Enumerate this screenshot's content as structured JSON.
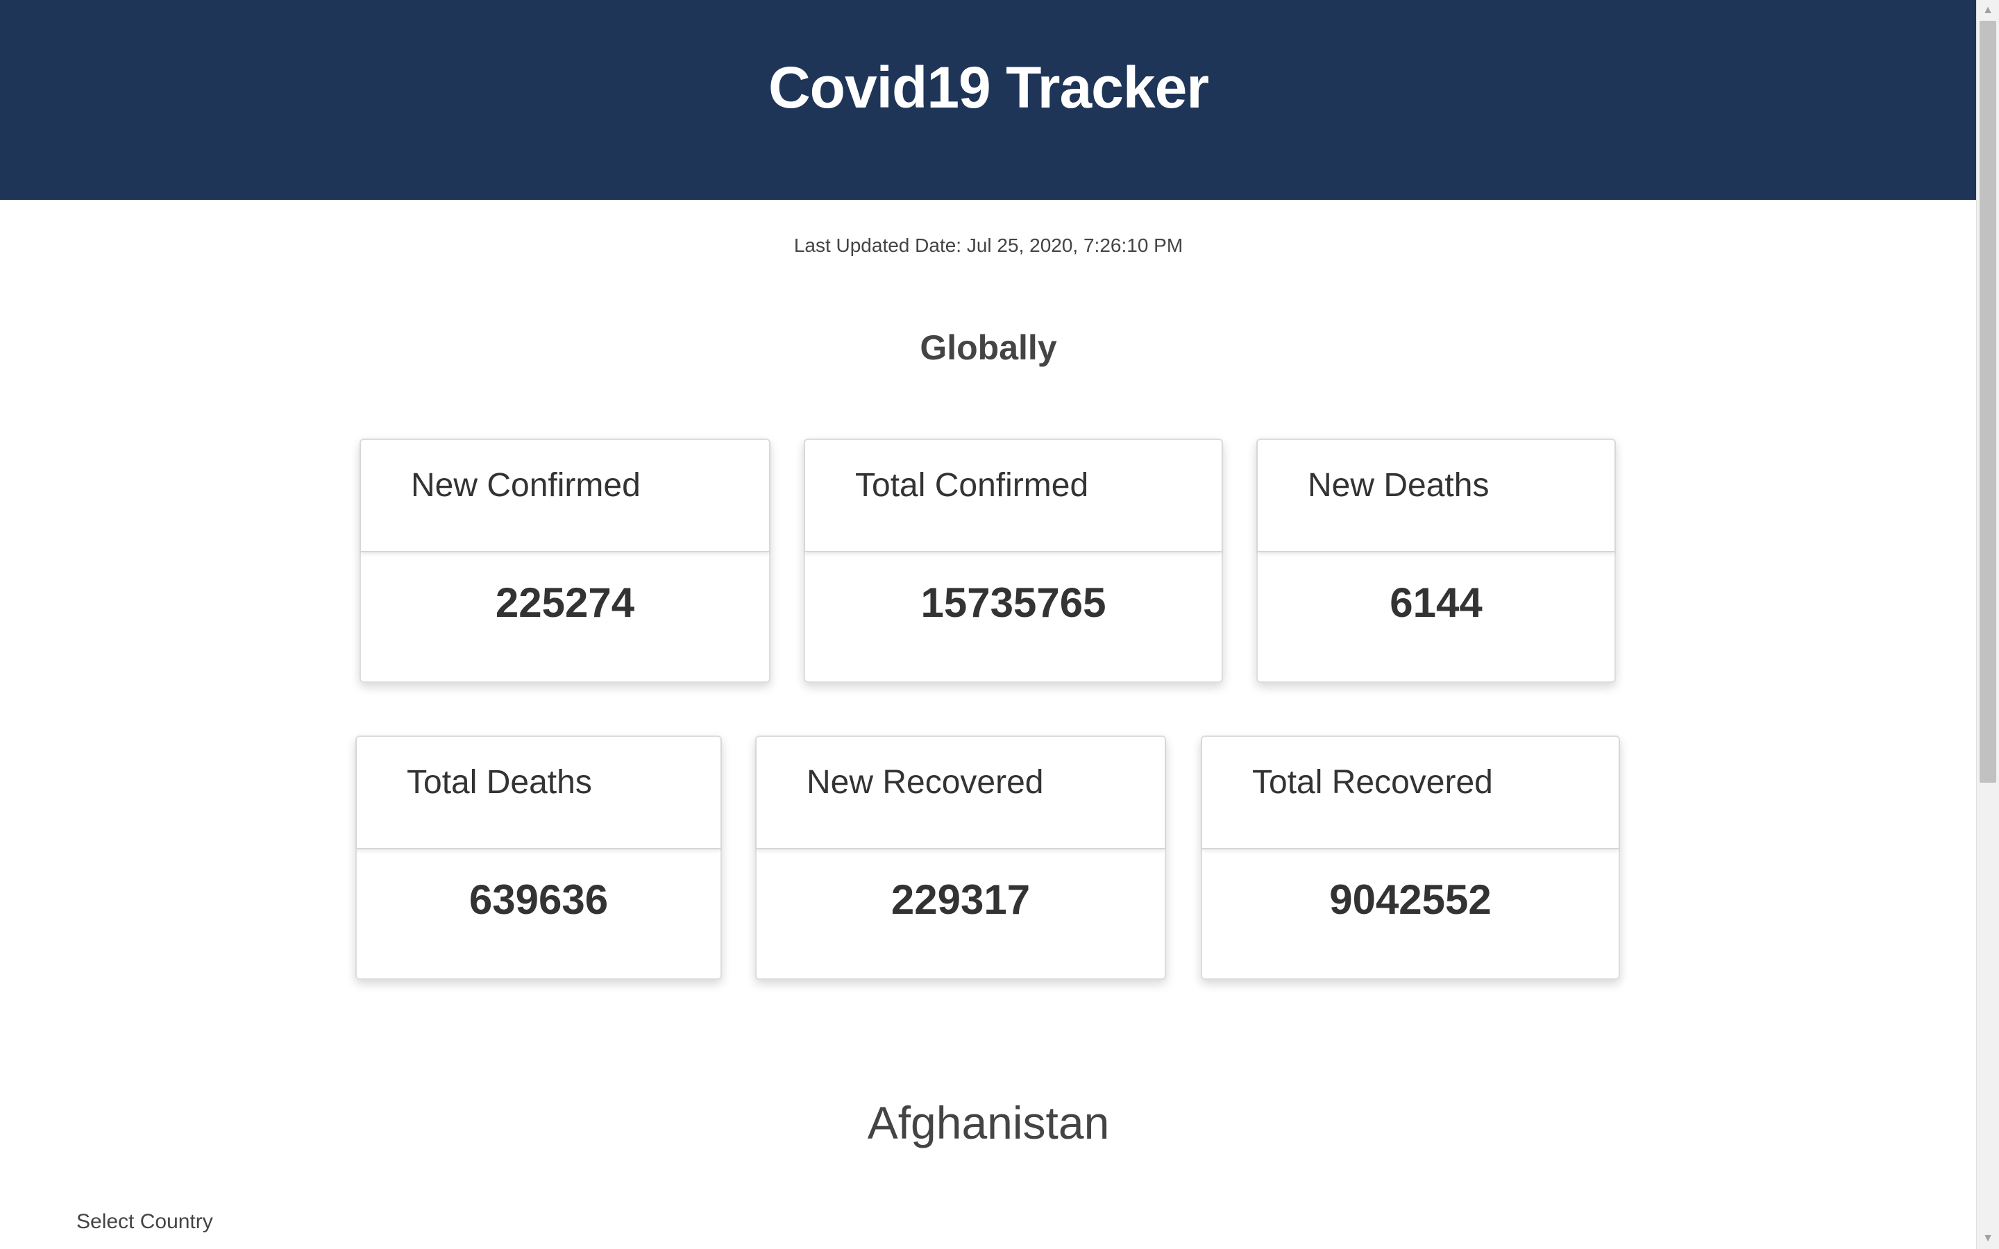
{
  "header": {
    "title": "Covid19 Tracker"
  },
  "last_updated": "Last Updated Date: Jul 25, 2020, 7:26:10 PM",
  "global": {
    "title": "Globally",
    "cards": [
      {
        "label": "New Confirmed",
        "value": "225274"
      },
      {
        "label": "Total Confirmed",
        "value": "15735765"
      },
      {
        "label": "New Deaths",
        "value": "6144"
      },
      {
        "label": "Total Deaths",
        "value": "639636"
      },
      {
        "label": "New Recovered",
        "value": "229317"
      },
      {
        "label": "Total Recovered",
        "value": "9042552"
      }
    ]
  },
  "country": {
    "title": "Afghanistan",
    "select_label": "Select Country"
  },
  "scrollbar": {
    "up_icon": "triangle-up-icon",
    "down_icon": "triangle-down-icon"
  },
  "colors": {
    "header_bg": "#1f3558",
    "header_text": "#ffffff",
    "text": "#333333"
  }
}
